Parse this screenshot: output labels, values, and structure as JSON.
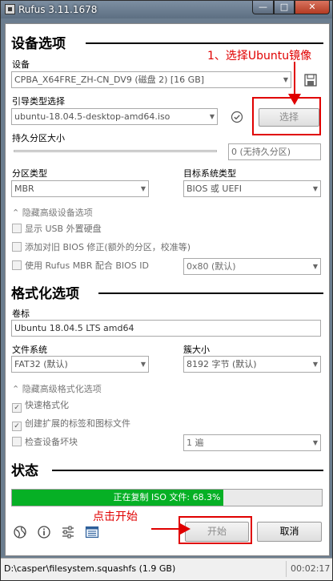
{
  "window": {
    "title": "Rufus 3.11.1678",
    "min_label": "—",
    "max_label": "□",
    "close_label": "✕"
  },
  "drive": {
    "section_title": "设备选项",
    "device_label": "设备",
    "device_value": "CPBA_X64FRE_ZH-CN_DV9 (磁盘 2) [16 GB]",
    "boot_label": "引导类型选择",
    "boot_value": "ubuntu-18.04.5-desktop-amd64.iso",
    "select_button": "选择",
    "persistent_label": "持久分区大小",
    "persistent_value": "0 (无持久分区)",
    "partition_label": "分区类型",
    "partition_value": "MBR",
    "target_label": "目标系统类型",
    "target_value": "BIOS 或 UEFI",
    "advanced_toggle": "隐藏高级设备选项",
    "opt_usb_hdd": "显示 USB 外置硬盘",
    "opt_bios_fix": "添加对旧 BIOS 修正(额外的分区，校准等)",
    "opt_rufus_mbr": "使用 Rufus MBR 配合 BIOS ID",
    "bios_id_value": "0x80 (默认)"
  },
  "format": {
    "section_title": "格式化选项",
    "volume_label": "卷标",
    "volume_value": "Ubuntu 18.04.5 LTS amd64",
    "fs_label": "文件系统",
    "fs_value": "FAT32 (默认)",
    "cluster_label": "簇大小",
    "cluster_value": "8192 字节 (默认)",
    "advanced_toggle": "隐藏高级格式化选项",
    "opt_quick": "快速格式化",
    "opt_extended": "创建扩展的标签和图标文件",
    "opt_badblocks": "检查设备坏块",
    "passes_value": "1 遍"
  },
  "status": {
    "section_title": "状态",
    "progress_text": "正在复制 ISO 文件: 68.3%",
    "progress_percent": 68.3,
    "start_button": "开始",
    "cancel_button": "取消",
    "statusbar_path": "D:\\casper\\filesystem.squashfs (1.9 GB)",
    "statusbar_time": "00:02:17"
  },
  "annotations": {
    "step1": "1、选择Ubuntu镜像",
    "click_start": "点击开始"
  },
  "colors": {
    "progress_fill": "#06b025",
    "annotation_red": "#e00000"
  },
  "icons": {
    "save": "save-icon",
    "check": "verify-icon",
    "globe": "language-icon",
    "info": "about-icon",
    "settings": "settings-icon",
    "log": "log-icon"
  }
}
